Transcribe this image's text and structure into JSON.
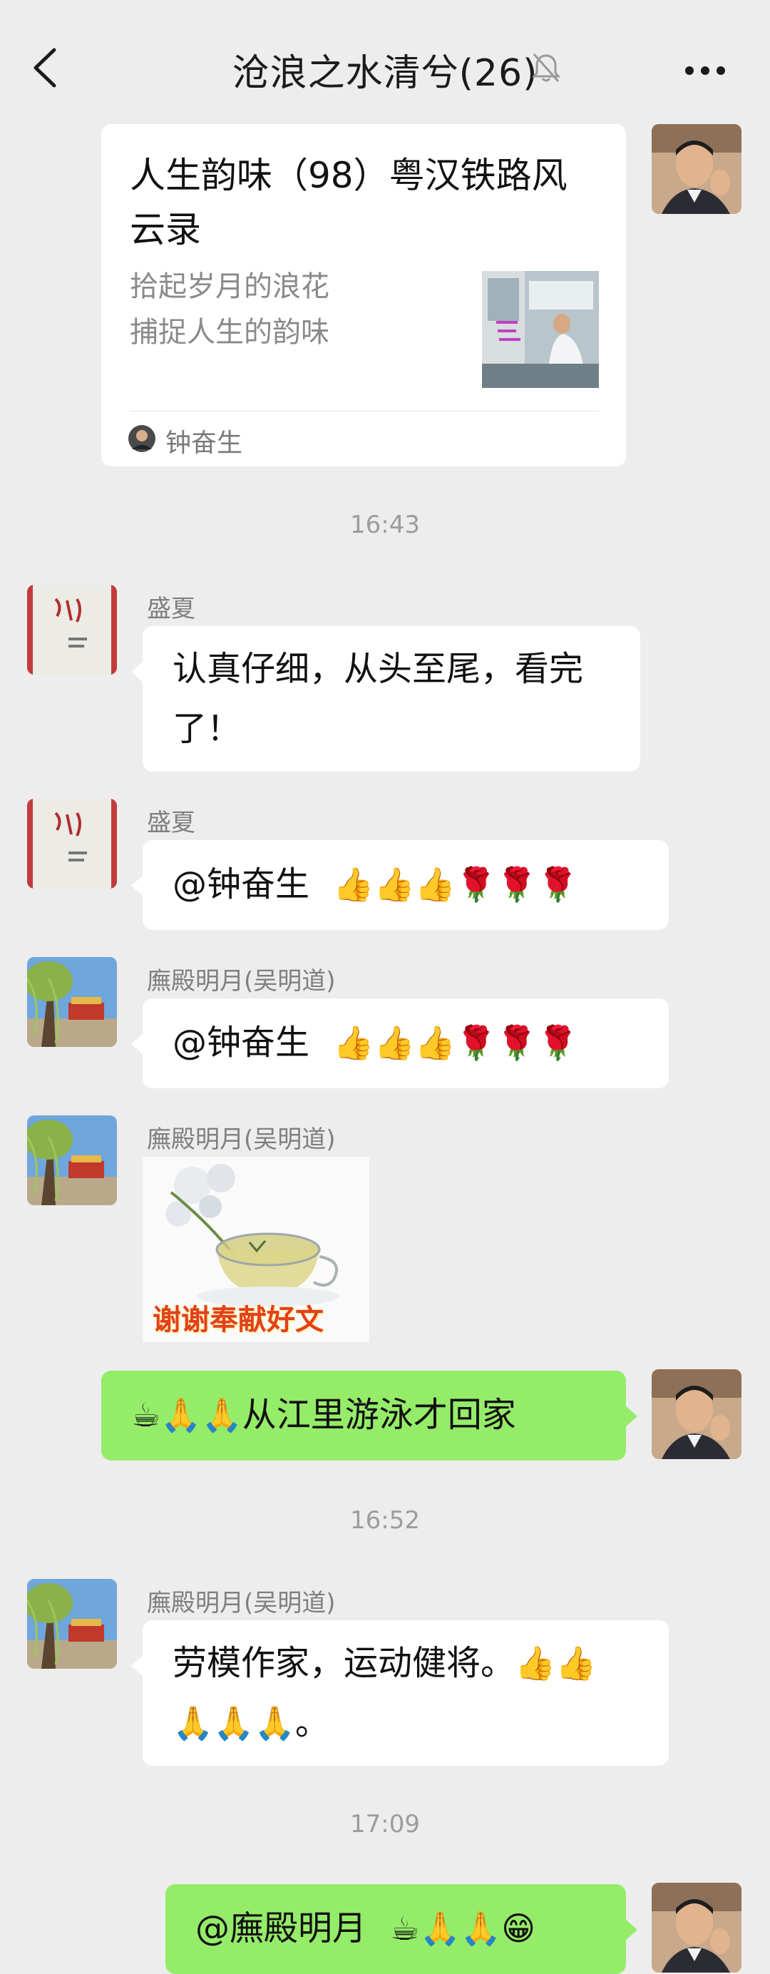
{
  "header": {
    "title": "沧浪之水清兮(26)"
  },
  "link_card": {
    "title": "人生韵味（98）粤汉铁路风云录",
    "desc_lines": [
      "拾起岁月的浪花",
      "捕捉人生的韵味"
    ],
    "source": "钟奋生"
  },
  "times": [
    "16:43",
    "16:52",
    "17:09"
  ],
  "messages": [
    {
      "sender": "盛夏",
      "lines": [
        "认真仔细，从头至尾，看完",
        "了！"
      ]
    },
    {
      "sender": "盛夏",
      "text": "@钟奋生",
      "emoji": "👍👍👍🌹🌹🌹"
    },
    {
      "sender": "廡殿明月(吴明道)",
      "text": "@钟奋生",
      "emoji": "👍👍👍🌹🌹🌹"
    },
    {
      "sender": "廡殿明月(吴明道)",
      "sticker_text": "谢谢奉献好文"
    },
    {
      "emoji": "☕🙏🙏",
      "text": "从江里游泳才回家"
    },
    {
      "sender": "廡殿明月(吴明道)",
      "line1_text": "劳模作家，运动健将。",
      "line1_emoji": "👍👍",
      "line2_emoji": "🙏🙏🙏",
      "line2_text": "。"
    },
    {
      "text": "@廡殿明月",
      "emoji": "☕🙏🙏😁"
    }
  ],
  "colors": {
    "bg": "#ededed",
    "self_bubble": "#95ec69",
    "other_bubble": "#ffffff"
  }
}
